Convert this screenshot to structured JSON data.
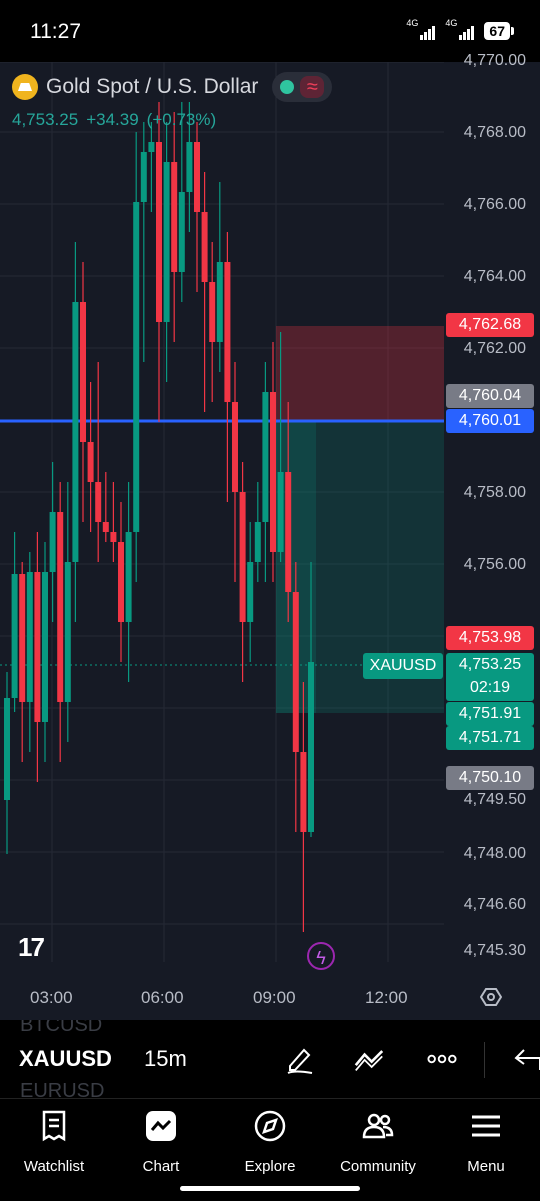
{
  "status": {
    "time": "11:27",
    "network1": "4G",
    "network2": "4G",
    "battery": "67"
  },
  "header": {
    "title": "Gold Spot / U.S. Dollar",
    "price": "4,753.25",
    "change": "+34.39",
    "change_pct": "(+0.73%)"
  },
  "chart": {
    "y_labels": [
      "4,770.00",
      "4,768.00",
      "4,766.00",
      "4,764.00",
      "4,762.00",
      "4,758.00",
      "4,756.00",
      "4,749.50",
      "4,748.00",
      "4,746.60",
      "4,745.30"
    ],
    "x_labels": [
      "03:00",
      "06:00",
      "09:00",
      "12:00"
    ],
    "tags": {
      "stop": "4,762.68",
      "ask_gray": "4,760.04",
      "entry": "4,760.01",
      "high_red": "4,753.98",
      "current": "4,753.25",
      "countdown": "02:19",
      "tp1": "4,751.91",
      "tp2": "4,751.71",
      "low_gray": "4,750.10"
    },
    "symbol_tag": "XAUUSD",
    "colors": {
      "up": "#089981",
      "down": "#f23645",
      "entry_line": "#2962ff",
      "background": "#161a25"
    }
  },
  "toolbar": {
    "symbol": "XAUUSD",
    "timeframe": "15m",
    "above_symbol": "BTCUSD",
    "below_symbol": "EURUSD"
  },
  "nav": {
    "items": [
      {
        "label": "Watchlist",
        "icon": "watchlist-icon"
      },
      {
        "label": "Chart",
        "icon": "chart-icon"
      },
      {
        "label": "Explore",
        "icon": "compass-icon"
      },
      {
        "label": "Community",
        "icon": "community-icon"
      },
      {
        "label": "Menu",
        "icon": "menu-icon"
      }
    ]
  }
}
